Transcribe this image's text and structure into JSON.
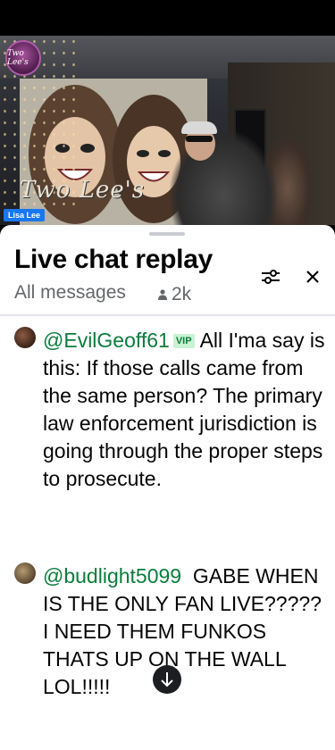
{
  "video": {
    "channel_name": "Lisa Lee",
    "mural_text": "Two Lee's",
    "avatar_text": "Two Lee's"
  },
  "chat": {
    "title": "Live chat replay",
    "filter_label": "All messages",
    "viewer_count": "2k",
    "icons": {
      "settings": "sliders-icon",
      "close": "close-icon",
      "viewers": "person-icon",
      "scroll": "arrow-down-icon"
    }
  },
  "comments": [
    {
      "author": "@EvilGeoff61",
      "badge": "VIP",
      "text": "All I'ma say is this: If those calls came from the same person? The primary law enforcement jurisdiction is going through the proper steps to prosecute.",
      "avatar_color": "#5a3a2c"
    },
    {
      "author": "@budlight5099",
      "badge": "",
      "text": "GABE WHEN IS THE ONLY FAN LIVE????? I NEED THEM FUNKOS THATS UP ON THE WALL LOL!!!!!",
      "avatar_color": "#6f5a3e"
    }
  ],
  "colors": {
    "author": "#0a7d3c",
    "badge_bg": "#c9f1d4",
    "accent": "#1877f2"
  }
}
